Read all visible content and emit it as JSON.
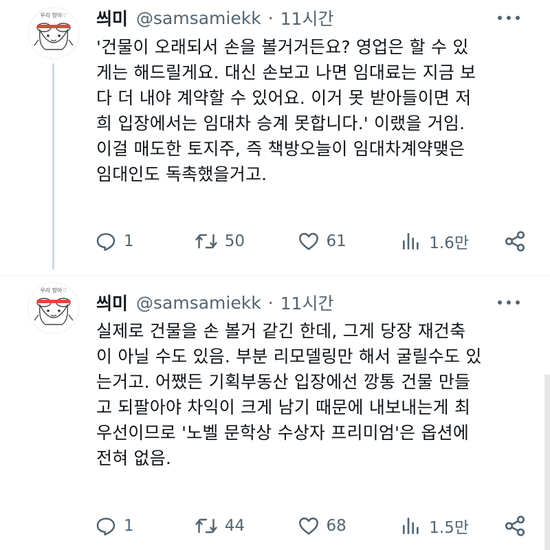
{
  "tweets": [
    {
      "name": "씌미",
      "handle": "@samsamiekk",
      "time": "11시간",
      "avatar_text": "우리 항아♡",
      "text": "'건물이 오래되서 손을 볼거거든요? 영업은 할 수 있\n게는 해드릴게요. 대신 손보고 나면 임대료는 지금 보\n다 더 내야 계약할 수 있어요. 이거 못 받아들이면 저\n희 입장에서는 임대차 승계 못합니다.' 이랬을 거임.\n이걸 매도한 토지주, 즉 책방오늘이 임대차계약맺은\n임대인도 독촉했을거고.",
      "replies": "1",
      "retweets": "50",
      "likes": "61",
      "views": "1.6만"
    },
    {
      "name": "씌미",
      "handle": "@samsamiekk",
      "time": "11시간",
      "avatar_text": "우리 항아♡",
      "text": "실제로 건물을 손 볼거 같긴 한데, 그게 당장 재건축\n이 아닐 수도 있음. 부분 리모델링만 해서 굴릴수도 있\n는거고. 어쨌든 기획부동산 입장에선 깡통 건물 만들\n고 되팔아야 차익이 크게 남기 때문에 내보내는게 최\n우선이므로 '노벨 문학상 수상자 프리미엄'은 옵션에\n전혀 없음.",
      "replies": "1",
      "retweets": "44",
      "likes": "68",
      "views": "1.5만"
    }
  ],
  "icons": {
    "reply": "reply-icon",
    "retweet": "retweet-icon",
    "like": "heart-icon",
    "views": "views-icon",
    "share": "share-icon",
    "more": "more-icon"
  },
  "colors": {
    "text": "#0f1419",
    "secondary": "#536471",
    "thread_line": "#cfd9de",
    "avatar_accent": "#e0463a"
  }
}
